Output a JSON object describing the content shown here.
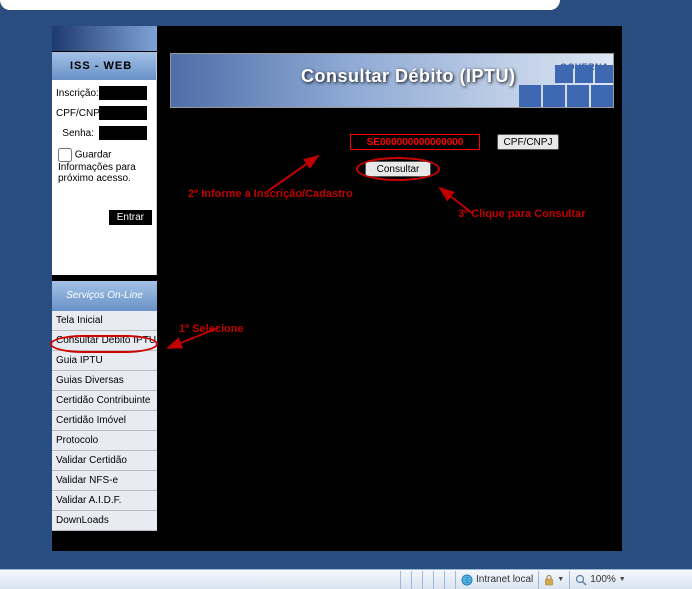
{
  "header": {
    "iss_web": "ISS - WEB"
  },
  "login": {
    "inscricao_label": "Inscrição:",
    "inscricao_value": "",
    "cpfcnpj_label": "CPF/CNPJ:",
    "cpfcnpj_value": "",
    "senha_label": "Senha:",
    "senha_value": "",
    "guardar_label": "Guardar Informações para próximo acesso.",
    "entrar_label": "Entrar"
  },
  "banner": {
    "title": "Consultar Débito (IPTU)",
    "brand": "GOVERNA"
  },
  "form": {
    "se_value": "SE000000000000000",
    "cpfcnpj_btn": "CPF/CNPJ",
    "consultar_btn": "Consultar"
  },
  "annotations": {
    "step1": "1º Selecione",
    "step2": "2º Informe a Inscrição/Cadastro",
    "step3": "3º Clique para Consultar"
  },
  "menu": {
    "header": "Serviços On-Line",
    "items": [
      "Tela Inicial",
      "Consultar Débito IPTU",
      "Guia IPTU",
      "Guias Diversas",
      "Certidão Contribuinte",
      "Certidão Imóvel",
      "Protocolo",
      "Validar Certidão",
      "Validar NFS-e",
      "Validar A.I.D.F.",
      "DownLoads"
    ]
  },
  "statusbar": {
    "zone": "Intranet local",
    "zoom": "100%"
  }
}
